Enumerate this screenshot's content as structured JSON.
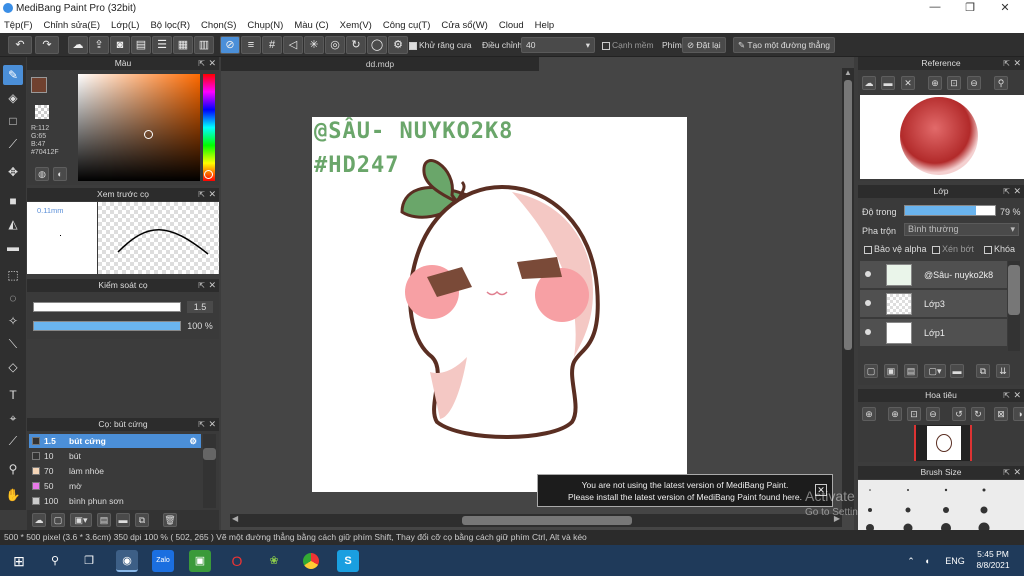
{
  "window": {
    "title": "MediBang Paint Pro (32bit)",
    "minimize": "—",
    "maximize": "❐",
    "close": "✕"
  },
  "menu": [
    "Tệp(F)",
    "Chỉnh sửa(E)",
    "Lớp(L)",
    "Bộ lọc(R)",
    "Chọn(S)",
    "Chụp(N)",
    "Màu (C)",
    "Xem(V)",
    "Công cụ(T)",
    "Cửa sổ(W)",
    "Cloud",
    "Help"
  ],
  "toolbar": {
    "antialias_label": "Khử răng cưa",
    "adjust_label": "Điều chỉnh",
    "adjust_value": "40",
    "edge_label": "Cạnh mềm",
    "key_label": "Phím",
    "reset_label": "Đặt lại",
    "new_line_label": "Tạo một đường thẳng"
  },
  "color_panel": {
    "title": "Màu",
    "r": "R:112",
    "g": "G:65",
    "b": "B:47",
    "hex": "#70412F",
    "primary_color": "#70412F"
  },
  "preview_panel": {
    "title": "Xem trước cọ",
    "size": "0.11mm"
  },
  "control_panel": {
    "title": "Kiểm soát cọ",
    "size_value": "1.5",
    "opacity_value": "100 %",
    "opacity_fraction": 1.0
  },
  "brush_panel": {
    "title": "Cọ: bút cứng",
    "items": [
      {
        "size": "1.5",
        "name": "bút cứng",
        "color": "#333333",
        "selected": true
      },
      {
        "size": "10",
        "name": "bút",
        "color": "#333333",
        "selected": false
      },
      {
        "size": "70",
        "name": "làm nhòe",
        "color": "#f5d6b8",
        "selected": false
      },
      {
        "size": "50",
        "name": "mờ",
        "color": "#e87ae8",
        "selected": false
      },
      {
        "size": "100",
        "name": "bình phun sơn",
        "color": "#cccccc",
        "selected": false
      }
    ]
  },
  "document": {
    "tab": "dd.mdp",
    "text_line1": "@SÂU- NUYKO2K8",
    "text_line2": "#HD247"
  },
  "notification": {
    "line1": "You are not using the latest version of MediBang Paint.",
    "line2": "Please install the latest version of MediBang Paint found here.",
    "close": "✕"
  },
  "watermark": {
    "line1": "Activate Windows",
    "line2": "Go to Settings to activate Windows."
  },
  "reference_panel": {
    "title": "Reference"
  },
  "layer_panel": {
    "title": "Lớp",
    "opacity_label": "Độ trong",
    "opacity_value": "79 %",
    "opacity_fraction": 0.79,
    "blend_label": "Pha trộn",
    "blend_value": "Bình thường",
    "protect_alpha": "Bảo vệ alpha",
    "clipping": "Xén bớt",
    "lock": "Khóa",
    "layers": [
      {
        "name": "@Sâu- nuyko2k8"
      },
      {
        "name": "Lớp3"
      },
      {
        "name": "Lớp1"
      }
    ]
  },
  "navigator_panel": {
    "title": "Hoa tiêu"
  },
  "brush_size_panel": {
    "title": "Brush Size"
  },
  "status": {
    "text": "500 * 500 pixel   (3.6 * 3.6cm)   350 dpi   100 %   ( 502, 265 )   Vẽ một đường thẳng bằng cách giữ phím Shift, Thay đổi cỡ cọ bằng cách giữ phím Ctrl, Alt và kéo"
  },
  "taskbar": {
    "lang": "ENG",
    "time": "5:45 PM",
    "date": "8/8/2021"
  }
}
